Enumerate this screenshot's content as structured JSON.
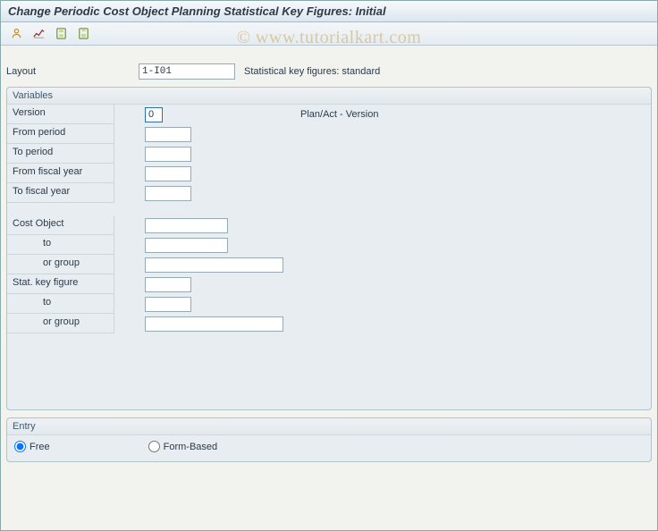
{
  "title": "Change Periodic Cost Object Planning Statistical Key Figures: Initial",
  "watermark": "© www.tutorialkart.com",
  "toolbar": {
    "icons": [
      "user-overview-icon",
      "overview-chart-icon",
      "save-data-icon",
      "save-icon"
    ]
  },
  "layout": {
    "label": "Layout",
    "value": "1-I01",
    "desc": "Statistical key figures: standard"
  },
  "variables": {
    "title": "Variables",
    "version": {
      "label": "Version",
      "value": "0",
      "desc": "Plan/Act - Version"
    },
    "from_period": {
      "label": "From period",
      "value": ""
    },
    "to_period": {
      "label": "To period",
      "value": ""
    },
    "from_fy": {
      "label": "From fiscal year",
      "value": ""
    },
    "to_fy": {
      "label": "To fiscal year",
      "value": ""
    },
    "cost_object": {
      "label": "Cost Object",
      "value": ""
    },
    "cost_object_to": {
      "label": "to",
      "value": ""
    },
    "cost_object_group": {
      "label": "or group",
      "value": ""
    },
    "skf": {
      "label": "Stat. key figure",
      "value": ""
    },
    "skf_to": {
      "label": "to",
      "value": ""
    },
    "skf_group": {
      "label": "or group",
      "value": ""
    }
  },
  "entry": {
    "title": "Entry",
    "free": "Free",
    "form": "Form-Based",
    "selected": "free"
  }
}
